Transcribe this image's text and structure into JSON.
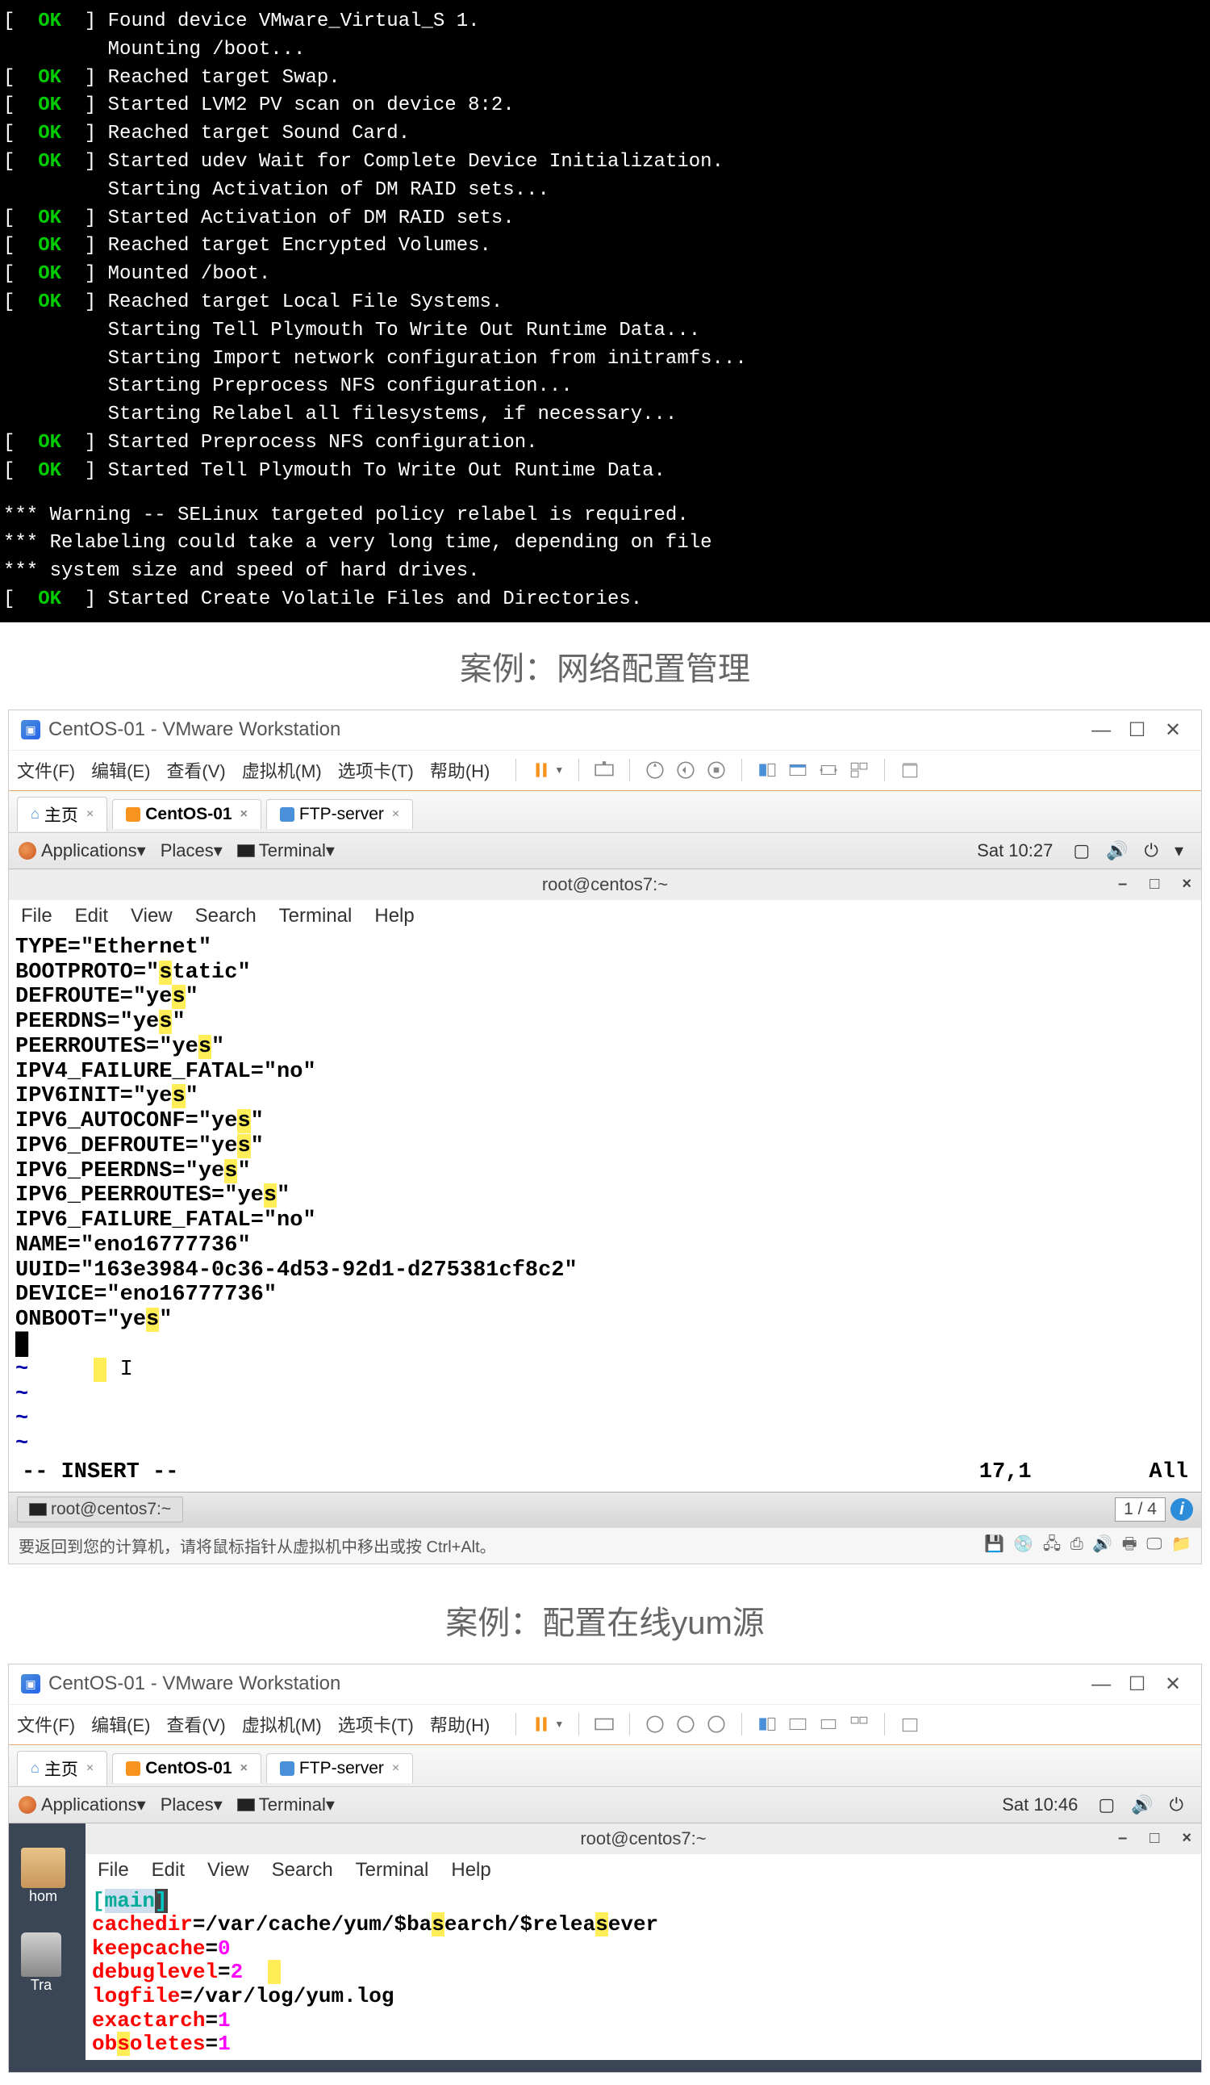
{
  "boot": {
    "lines": [
      {
        "status": "OK",
        "text": "Found device VMware_Virtual_S 1."
      },
      {
        "indent": true,
        "text": "Mounting /boot..."
      },
      {
        "status": "OK",
        "text": "Reached target Swap."
      },
      {
        "status": "OK",
        "text": "Started LVM2 PV scan on device 8:2."
      },
      {
        "status": "OK",
        "text": "Reached target Sound Card."
      },
      {
        "status": "OK",
        "text": "Started udev Wait for Complete Device Initialization."
      },
      {
        "indent": true,
        "text": "Starting Activation of DM RAID sets..."
      },
      {
        "status": "OK",
        "text": "Started Activation of DM RAID sets."
      },
      {
        "status": "OK",
        "text": "Reached target Encrypted Volumes."
      },
      {
        "status": "OK",
        "text": "Mounted /boot."
      },
      {
        "status": "OK",
        "text": "Reached target Local File Systems."
      },
      {
        "indent": true,
        "text": "Starting Tell Plymouth To Write Out Runtime Data..."
      },
      {
        "indent": true,
        "text": "Starting Import network configuration from initramfs..."
      },
      {
        "indent": true,
        "text": "Starting Preprocess NFS configuration..."
      },
      {
        "indent": true,
        "text": "Starting Relabel all filesystems, if necessary..."
      },
      {
        "status": "OK",
        "text": "Started Preprocess NFS configuration."
      },
      {
        "status": "OK",
        "text": "Started Tell Plymouth To Write Out Runtime Data."
      }
    ],
    "warnings": [
      "*** Warning -- SELinux targeted policy relabel is required.",
      "*** Relabeling could take a very long time, depending on file",
      "*** system size and speed of hard drives."
    ],
    "final": {
      "status": "OK",
      "text": "Started Create Volatile Files and Directories."
    }
  },
  "caption1": "案例：网络配置管理",
  "caption2": "案例：配置在线yum源",
  "vmware": {
    "title": "CentOS-01 - VMware Workstation",
    "menus": {
      "file": "文件(F)",
      "edit": "编辑(E)",
      "view": "查看(V)",
      "vm": "虚拟机(M)",
      "tabs": "选项卡(T)",
      "help": "帮助(H)"
    },
    "tabs": {
      "home": "主页",
      "centos": "CentOS-01",
      "ftp": "FTP-server"
    }
  },
  "gnome1": {
    "apps": "Applications",
    "places": "Places",
    "terminal": "Terminal",
    "time": "Sat 10:27"
  },
  "terminal1": {
    "title": "root@centos7:~",
    "menus": {
      "file": "File",
      "edit": "Edit",
      "view": "View",
      "search": "Search",
      "terminal": "Terminal",
      "help": "Help"
    },
    "config": {
      "l1a": "TYPE=\"Ethernet\"",
      "l2a": "BOOTPROTO=\"",
      "l2b": "s",
      "l2c": "tatic\"",
      "l3a": "DEFROUTE=\"ye",
      "l3b": "s",
      "l3c": "\"",
      "l4a": "PEERDNS=\"ye",
      "l4b": "s",
      "l4c": "\"",
      "l5a": "PEERROUTES=\"ye",
      "l5b": "s",
      "l5c": "\"",
      "l6a": "IPV4_FAILURE_FATAL=\"no\"",
      "l7a": "IPV6INIT=\"ye",
      "l7b": "s",
      "l7c": "\"",
      "l8a": "IPV6_AUTOCONF=\"ye",
      "l8b": "s",
      "l8c": "\"",
      "l9a": "IPV6_DEFROUTE=\"ye",
      "l9b": "s",
      "l9c": "\"",
      "l10a": "IPV6_PEERDNS=\"ye",
      "l10b": "s",
      "l10c": "\"",
      "l11a": "IPV6_PEERROUTES=\"ye",
      "l11b": "s",
      "l11c": "\"",
      "l12a": "IPV6_FAILURE_FATAL=\"no\"",
      "l13a": "NAME=\"eno16777736\"",
      "l14a": "UUID=\"163e3984-0c36-4d53-92d1-d275381cf8c2\"",
      "l15a": "DEVICE=\"eno16777736\"",
      "l16a": "ONBOOT=\"ye",
      "l16b": "s",
      "l16c": "\"",
      "tilde": "~"
    },
    "mode": "-- INSERT --",
    "position": "17,1",
    "scroll": "All",
    "task": "root@centos7:~",
    "pager": "1 / 4"
  },
  "hint": "要返回到您的计算机，请将鼠标指针从虚拟机中移出或按 Ctrl+Alt。",
  "gnome2": {
    "apps": "Applications",
    "places": "Places",
    "terminal": "Terminal",
    "time": "Sat 10:46"
  },
  "terminal2": {
    "title": "root@centos7:~",
    "menus": {
      "file": "File",
      "edit": "Edit",
      "view": "View",
      "search": "Search",
      "terminal": "Terminal",
      "help": "Help"
    },
    "home_label": "hom",
    "trash_label": "Tra",
    "yum": {
      "main_l": "[",
      "main": "main",
      "main_r": "]",
      "cachedir_k": "cachedir",
      "cachedir_a": "=/var/cache/yum/$ba",
      "cachedir_s1": "s",
      "cachedir_b": "earch/$relea",
      "cachedir_s2": "s",
      "cachedir_c": "ever",
      "keepcache_k": "keepcache",
      "keepcache_eq": "=",
      "keepcache_v": "0",
      "debuglevel_k": "debuglevel",
      "debuglevel_eq": "=",
      "debuglevel_v": "2",
      "logfile_k": "logfile",
      "logfile_v": "=/var/log/yum.log",
      "exactarch_k": "exactarch",
      "exactarch_eq": "=",
      "exactarch_v": "1",
      "obsoletes_k": "ob",
      "obsoletes_s": "s",
      "obsoletes_k2": "oletes",
      "obsoletes_eq": "=",
      "obsoletes_v": "1"
    }
  }
}
